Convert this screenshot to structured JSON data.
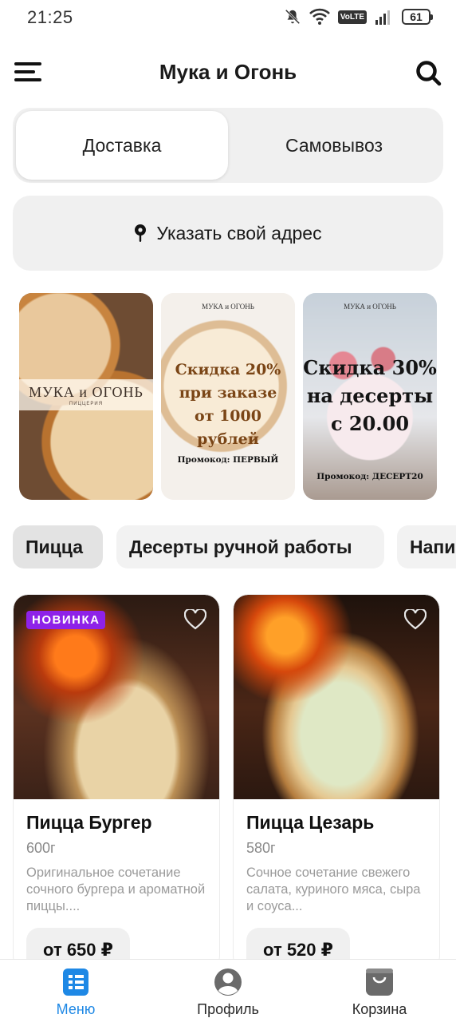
{
  "status_bar": {
    "time": "21:25",
    "volte": "VoLTE",
    "battery": "61"
  },
  "header": {
    "title": "Мука и Огонь"
  },
  "delivery": {
    "options": [
      "Доставка",
      "Самовывоз"
    ],
    "selected": "Доставка"
  },
  "address": {
    "label": "Указать свой адрес"
  },
  "promos": [
    {
      "brand": "МУКА и ОГОНЬ",
      "subtitle": "ПИЦЦЕРИЯ"
    },
    {
      "brand": "МУКА и ОГОНЬ",
      "line1": "Скидка 20%",
      "line2": "при заказе",
      "line3": "от 1000 рублей",
      "promo": "Промокод: ПЕРВЫЙ"
    },
    {
      "brand": "МУКА и ОГОНЬ",
      "line1": "Скидка 30%",
      "line2": "на десерты",
      "line3": "с 20.00",
      "promo": "Промокод: ДЕСЕРТ20"
    }
  ],
  "categories": [
    "Пицца",
    "Десерты ручной работы",
    "Напи"
  ],
  "active_category": "Пицца",
  "products": [
    {
      "badge": "НОВИНКА",
      "name": "Пицца Бургер",
      "weight": "600г",
      "description": "Оригинальное сочетание сочного бургера и ароматной пиццы....",
      "price": "от 650 ₽"
    },
    {
      "name": "Пицца Цезарь",
      "weight": "580г",
      "description": "Сочное сочетание свежего салата, куриного мяса, сыра и соуса...",
      "price": "от 520 ₽"
    }
  ],
  "bottom_nav": {
    "items": [
      "Меню",
      "Профиль",
      "Корзина"
    ],
    "active": "Меню",
    "accent_color": "#1e88e5"
  },
  "colors": {
    "badge": "#8e22e8",
    "chip_bg": "#f2f2f2",
    "panel_bg": "#f0f0f0"
  }
}
